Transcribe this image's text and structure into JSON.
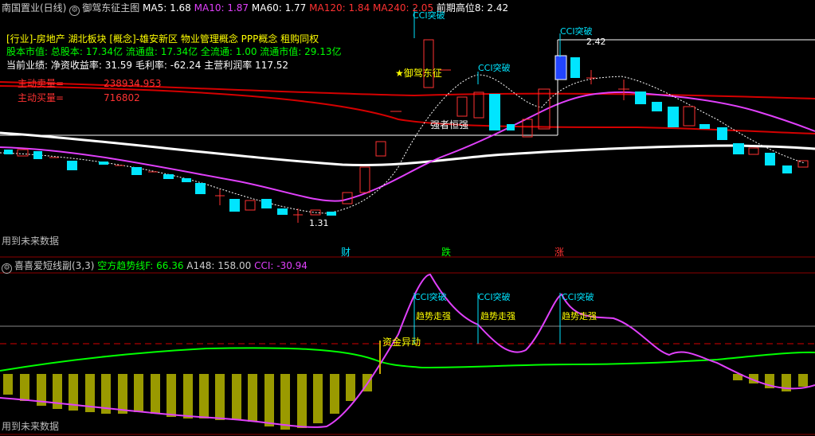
{
  "colors": {
    "bg": "#000000",
    "up": "#ff3232",
    "down": "#00e5ff",
    "ma_purple": "#e040fb",
    "ma_white": "#ffffff",
    "ma_red": "#d40000",
    "yellow": "#ffff00",
    "green": "#00ff00",
    "olive": "#9a9a00"
  },
  "header": {
    "stock": "南国置业(日线)",
    "indicator": "御驾东征主图",
    "ma5": "MA5: 1.68",
    "ma10": "MA10: 1.87",
    "ma60": "MA60: 1.77",
    "ma120": "MA120: 1.84",
    "ma240": "MA240: 2.05",
    "prev_high": "前期高位8: 2.42"
  },
  "info": {
    "industry": "[行业]-房地产 湖北板块 [概念]-雄安新区 物业管理概念 PPP概念 租购同权",
    "capital": "股本市值: 总股本: 17.34亿 流通盘: 17.34亿 全流通: 1.00 流通市值: 29.13亿",
    "performance": "当前业绩: 净资收益率: 31.59 毛利率: -62.24 主营利润率 117.52",
    "sell_label": "主动卖量=",
    "sell_value": "238934.953",
    "buy_label": "主动买量=",
    "buy_value": "716802"
  },
  "main_annotations": {
    "cci1": "CCI突破",
    "cci2": "CCI突破",
    "cci3": "CCI突破",
    "yujia": "★御驾东征",
    "strong": "强者恒强",
    "high_val": "2.42",
    "low_val": "1.31",
    "future": "用到未来数据",
    "cai": "财",
    "die": "跌",
    "zhang": "涨"
  },
  "sub": {
    "title": "喜喜爱短线副(3,3)",
    "trend": "空方趋势线F: 66.36",
    "a148": "A148: 158.00",
    "cci": "CCI: -30.94",
    "cci1": "CCI突破",
    "cci2": "CCI突破",
    "cci3": "CCI突破",
    "trend1": "趋势走强",
    "trend2": "趋势走强",
    "trend3": "趋势走强",
    "fund": "资金异动",
    "future": "用到未来数据"
  },
  "chart_data": [
    {
      "type": "candlestick",
      "price_range": [
        1.2,
        2.7
      ],
      "marked_high": 2.42,
      "marked_low": 1.31,
      "moving_averages": [
        {
          "name": "MA5",
          "last": 1.68
        },
        {
          "name": "MA10",
          "last": 1.87
        },
        {
          "name": "MA60",
          "last": 1.77
        },
        {
          "name": "MA120",
          "last": 1.84
        },
        {
          "name": "MA240",
          "last": 2.05
        }
      ]
    },
    {
      "type": "line",
      "series": [
        {
          "name": "空方趋势线F",
          "last": 66.36
        },
        {
          "name": "A148",
          "last": 158.0
        },
        {
          "name": "CCI",
          "last": -30.94
        }
      ]
    }
  ]
}
